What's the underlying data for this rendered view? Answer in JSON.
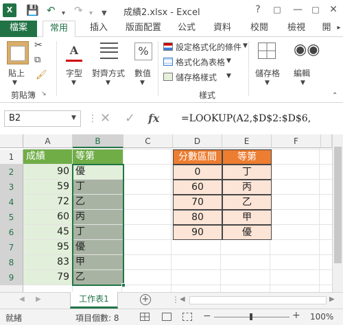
{
  "titlebar": {
    "app_icon": "X",
    "title": "成績2.xlsx - Excel",
    "help": "?",
    "quick_access": [
      "save-icon",
      "undo-icon",
      "redo-icon",
      "customize-icon"
    ]
  },
  "ribbon_tabs": [
    "檔案",
    "常用",
    "插入",
    "版面配置",
    "公式",
    "資料",
    "校閱",
    "檢視",
    "開"
  ],
  "ribbon": {
    "paste": "貼上",
    "clipboard": "剪貼簿",
    "font": "字型",
    "align": "對齊方式",
    "number": "數值",
    "cond_format": "設定格式化的條件",
    "format_table": "格式化為表格",
    "cell_styles": "儲存格樣式",
    "styles": "樣式",
    "cells": "儲存格",
    "edit": "編輯"
  },
  "formula_bar": {
    "name_box": "B2",
    "fx": "fx",
    "formula": "=LOOKUP(A2,$D$2:$D$6,"
  },
  "columns": [
    "A",
    "B",
    "C",
    "D",
    "E",
    "F"
  ],
  "rows": [
    "1",
    "2",
    "3",
    "4",
    "5",
    "6",
    "7",
    "8",
    "9"
  ],
  "table1": {
    "header": [
      "成績",
      "等第"
    ],
    "data": [
      [
        "90",
        "優"
      ],
      [
        "59",
        "丁"
      ],
      [
        "72",
        "乙"
      ],
      [
        "60",
        "丙"
      ],
      [
        "45",
        "丁"
      ],
      [
        "95",
        "優"
      ],
      [
        "83",
        "甲"
      ],
      [
        "79",
        "乙"
      ]
    ]
  },
  "table2": {
    "header": [
      "分數區間",
      "等第"
    ],
    "data": [
      [
        "0",
        "丁"
      ],
      [
        "60",
        "丙"
      ],
      [
        "70",
        "乙"
      ],
      [
        "80",
        "甲"
      ],
      [
        "90",
        "優"
      ]
    ]
  },
  "sheet_tab": "工作表1",
  "status": {
    "ready": "就緒",
    "count": "項目個數: 8",
    "zoom": "100%"
  },
  "colors": {
    "excel_green": "#217346",
    "header_green": "#70ad47",
    "orange": "#ed7d31",
    "peach": "#fce4d6",
    "sel_gray": "#a9b3a3",
    "light_green": "#e2efda"
  }
}
